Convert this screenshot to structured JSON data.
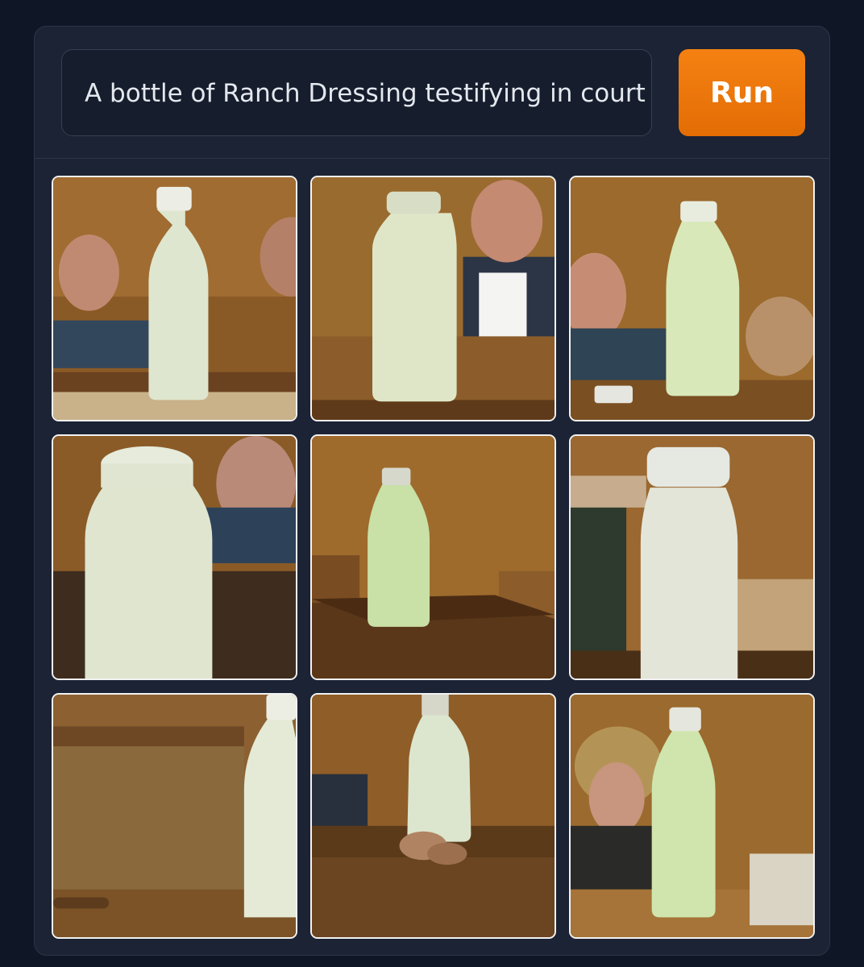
{
  "prompt": {
    "value": "A bottle of Ranch Dressing testifying in court"
  },
  "run_button": {
    "label": "Run",
    "color": "#f07a0c"
  },
  "results": {
    "count": 9,
    "tile_border_color": "#f2f2f2",
    "images": [
      {
        "depicts": "ranch-bottle-court-image"
      },
      {
        "depicts": "ranch-bottle-court-image"
      },
      {
        "depicts": "ranch-bottle-court-image"
      },
      {
        "depicts": "ranch-bottle-court-image"
      },
      {
        "depicts": "ranch-bottle-court-image"
      },
      {
        "depicts": "ranch-bottle-court-image"
      },
      {
        "depicts": "ranch-bottle-court-image"
      },
      {
        "depicts": "ranch-bottle-court-image"
      },
      {
        "depicts": "ranch-bottle-court-image"
      }
    ]
  }
}
